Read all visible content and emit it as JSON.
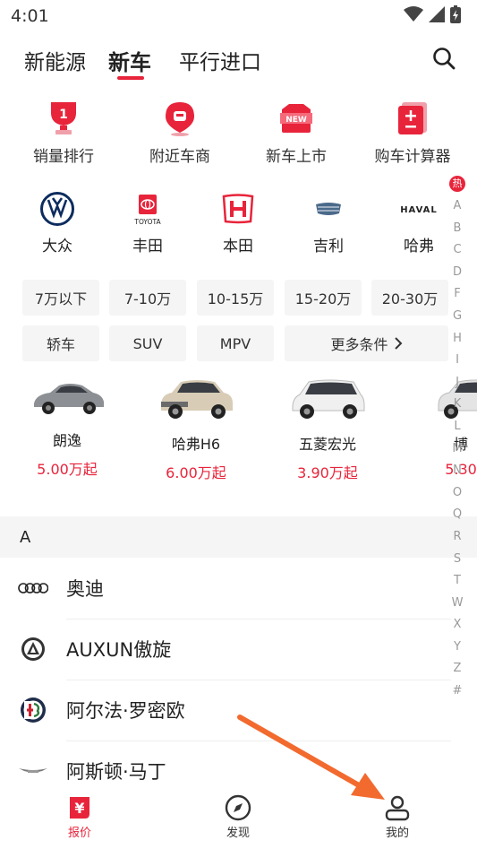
{
  "status_bar": {
    "time": "4:01"
  },
  "top_tabs": [
    {
      "label": "新能源"
    },
    {
      "label": "新车"
    },
    {
      "label": "平行进口"
    }
  ],
  "tools": [
    {
      "label": "销量排行",
      "icon": "trophy-icon",
      "badge": "1"
    },
    {
      "label": "附近车商",
      "icon": "location-pin-icon"
    },
    {
      "label": "新车上市",
      "icon": "new-badge-icon",
      "badge": "NEW"
    },
    {
      "label": "购车计算器",
      "icon": "calculator-icon"
    }
  ],
  "brands": [
    {
      "label": "大众",
      "icon": "volkswagen-logo-icon"
    },
    {
      "label": "丰田",
      "icon": "toyota-logo-icon",
      "logo_text": "TOYOTA"
    },
    {
      "label": "本田",
      "icon": "honda-logo-icon"
    },
    {
      "label": "吉利",
      "icon": "geely-logo-icon"
    },
    {
      "label": "哈弗",
      "icon": "haval-logo-icon",
      "logo_text": "HAVAL"
    }
  ],
  "price_filters": [
    "7万以下",
    "7-10万",
    "10-15万",
    "15-20万",
    "20-30万"
  ],
  "type_filters": [
    "轿车",
    "SUV",
    "MPV"
  ],
  "more_filters": "更多条件",
  "hot_cars": [
    {
      "name": "朗逸",
      "price": "5.00万起"
    },
    {
      "name": "哈弗H6",
      "price": "6.00万起"
    },
    {
      "name": "五菱宏光",
      "price": "3.90万起"
    },
    {
      "name": "博",
      "price": "5.30"
    }
  ],
  "section_letter": "A",
  "brand_list": [
    {
      "name": "奥迪",
      "icon": "audi-logo-icon"
    },
    {
      "name": "AUXUN傲旋",
      "icon": "auxun-logo-icon"
    },
    {
      "name": "阿尔法·罗密欧",
      "icon": "alfa-romeo-logo-icon"
    },
    {
      "name": "阿斯顿·马丁",
      "icon": "aston-martin-logo-icon"
    }
  ],
  "index_bar": {
    "hot": "热",
    "letters": [
      "A",
      "B",
      "C",
      "D",
      "F",
      "G",
      "H",
      "I",
      "J",
      "K",
      "L",
      "M",
      "N",
      "O",
      "Q",
      "R",
      "S",
      "T",
      "W",
      "X",
      "Y",
      "Z",
      "#"
    ]
  },
  "bottom_nav": [
    {
      "label": "报价",
      "icon": "price-tag-icon",
      "glyph": "¥",
      "active": true
    },
    {
      "label": "发现",
      "icon": "compass-icon"
    },
    {
      "label": "我的",
      "icon": "profile-icon"
    }
  ],
  "colors": {
    "accent": "#e8243b",
    "chip_bg": "#f5f5f5",
    "section_bg": "#f5f5f5",
    "annotation_arrow": "#f26a2e"
  }
}
